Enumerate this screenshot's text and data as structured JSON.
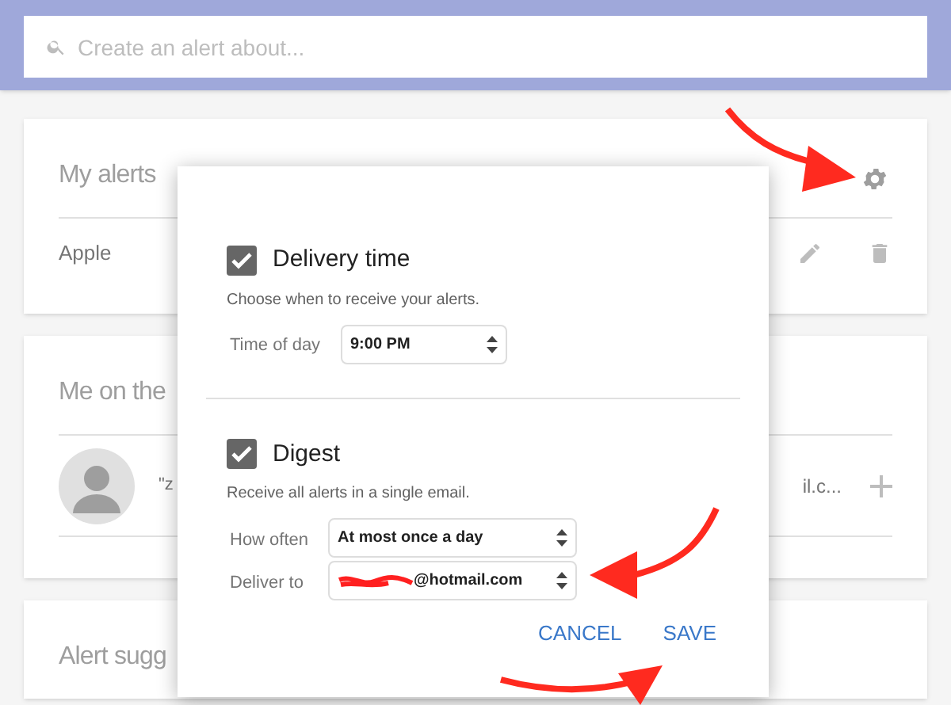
{
  "search": {
    "placeholder": "Create an alert about..."
  },
  "cards": [
    {
      "kind": "alerts",
      "title": "My alerts",
      "rows": [
        {
          "label": "Apple"
        }
      ]
    },
    {
      "kind": "me",
      "title": "Me on the",
      "rows": [
        {
          "left": "\"z",
          "right": "il.c..."
        }
      ]
    },
    {
      "kind": "suggestions",
      "title": "Alert sugg"
    }
  ],
  "dialog": {
    "sections": [
      {
        "title": "Delivery time",
        "checked": true,
        "description": "Choose when to receive your alerts.",
        "fields": [
          {
            "label": "Time of day",
            "value": "9:00 PM",
            "redacted": false
          }
        ]
      },
      {
        "title": "Digest",
        "checked": true,
        "description": "Receive all alerts in a single email.",
        "fields": [
          {
            "label": "How often",
            "value": "At most once a day",
            "redacted": false
          },
          {
            "label": "Deliver to",
            "value": "@hotmail.com",
            "redacted": true
          }
        ]
      }
    ],
    "buttons": [
      "CANCEL",
      "SAVE"
    ]
  }
}
